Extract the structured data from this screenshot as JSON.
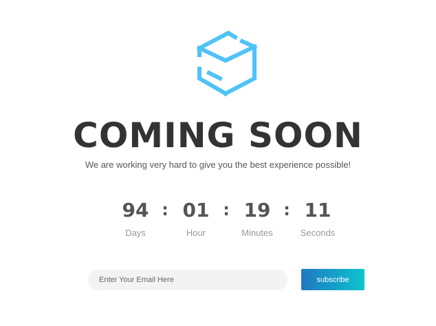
{
  "brand": {
    "logo_icon": "isometric-box-icon",
    "accent_color": "#4fc3f7"
  },
  "hero": {
    "title": "COMING SOON",
    "subtitle": "We are working very hard to give you the best experience possible!"
  },
  "countdown": {
    "days": {
      "value": "94",
      "label": "Days"
    },
    "hours": {
      "value": "01",
      "label": "Hour"
    },
    "minutes": {
      "value": "19",
      "label": "Minutes"
    },
    "seconds": {
      "value": "11",
      "label": "Seconds"
    },
    "separator": ":"
  },
  "newsletter": {
    "email_placeholder": "Enter Your Email Here",
    "email_value": "",
    "subscribe_label": "subscribe",
    "button_gradient": [
      "#1f78c2",
      "#0cc4cf"
    ]
  }
}
